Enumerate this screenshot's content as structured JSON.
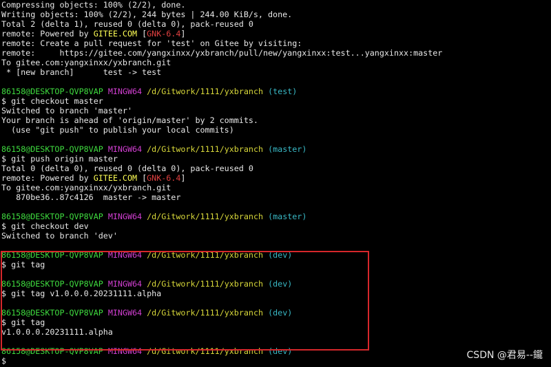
{
  "lines": [
    {
      "t": "Compressing objects: 100% (2/2), done."
    },
    {
      "t": "Writing objects: 100% (2/2), 244 bytes | 244.00 KiB/s, done."
    },
    {
      "t": "Total 2 (delta 1), reused 0 (delta 0), pack-reused 0"
    },
    {
      "remote_prefix": "remote: Powered by ",
      "brand": "GITEE.COM",
      "bracket_open": " [",
      "version": "GNK-6.4",
      "bracket_close": "]"
    },
    {
      "t": "remote: Create a pull request for 'test' on Gitee by visiting:"
    },
    {
      "t": "remote:     https://gitee.com/yangxinxx/yxbranch/pull/new/yangxinxx:test...yangxinxx:master"
    },
    {
      "t": "To gitee.com:yangxinxx/yxbranch.git"
    },
    {
      "t": " * [new branch]      test -> test"
    },
    {
      "t": ""
    },
    {
      "user": "86158@DESKTOP-QVP8VAP",
      "shell": "MINGW64",
      "path": "/d/Gitwork/1111/yxbranch",
      "branch": "(test)"
    },
    {
      "t": "$ git checkout master"
    },
    {
      "t": "Switched to branch 'master'"
    },
    {
      "t": "Your branch is ahead of 'origin/master' by 2 commits."
    },
    {
      "t": "  (use \"git push\" to publish your local commits)"
    },
    {
      "t": ""
    },
    {
      "user": "86158@DESKTOP-QVP8VAP",
      "shell": "MINGW64",
      "path": "/d/Gitwork/1111/yxbranch",
      "branch": "(master)"
    },
    {
      "t": "$ git push origin master"
    },
    {
      "t": "Total 0 (delta 0), reused 0 (delta 0), pack-reused 0"
    },
    {
      "remote_prefix": "remote: Powered by ",
      "brand": "GITEE.COM",
      "bracket_open": " [",
      "version": "GNK-6.4",
      "bracket_close": "]"
    },
    {
      "t": "To gitee.com:yangxinxx/yxbranch.git"
    },
    {
      "t": "   870be36..87c4126  master -> master"
    },
    {
      "t": ""
    },
    {
      "user": "86158@DESKTOP-QVP8VAP",
      "shell": "MINGW64",
      "path": "/d/Gitwork/1111/yxbranch",
      "branch": "(master)"
    },
    {
      "t": "$ git checkout dev"
    },
    {
      "t": "Switched to branch 'dev'"
    },
    {
      "t": ""
    },
    {
      "user": "86158@DESKTOP-QVP8VAP",
      "shell": "MINGW64",
      "path": "/d/Gitwork/1111/yxbranch",
      "branch": "(dev)"
    },
    {
      "t": "$ git tag"
    },
    {
      "t": ""
    },
    {
      "user": "86158@DESKTOP-QVP8VAP",
      "shell": "MINGW64",
      "path": "/d/Gitwork/1111/yxbranch",
      "branch": "(dev)"
    },
    {
      "t": "$ git tag v1.0.0.0.20231111.alpha"
    },
    {
      "t": ""
    },
    {
      "user": "86158@DESKTOP-QVP8VAP",
      "shell": "MINGW64",
      "path": "/d/Gitwork/1111/yxbranch",
      "branch": "(dev)"
    },
    {
      "t": "$ git tag"
    },
    {
      "t": "v1.0.0.0.20231111.alpha"
    },
    {
      "t": ""
    },
    {
      "user": "86158@DESKTOP-QVP8VAP",
      "shell": "MINGW64",
      "path": "/d/Gitwork/1111/yxbranch",
      "branch": "(dev)"
    },
    {
      "t": "$"
    }
  ],
  "watermark": "CSDN @君易--鑨",
  "colors": {
    "background": "#000000",
    "text": "#e8e8e8",
    "user": "#3fdc3f",
    "shell": "#d23fd2",
    "path": "#d8d83a",
    "branch": "#39b9c6",
    "gitee_brand": "#e04040",
    "highlight_border": "#d7272b"
  }
}
